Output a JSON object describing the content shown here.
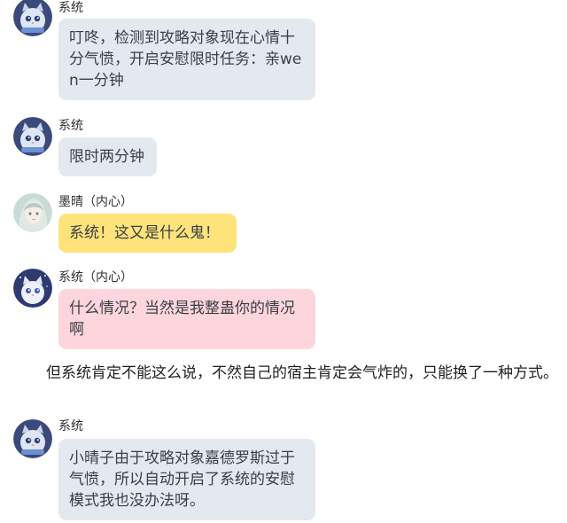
{
  "messages": [
    {
      "sender": "系统",
      "avatar": "cat-avatar-icon",
      "text": "叮咚，检测到攻略对象现在心情十分气愤，开启安慰限时任务：亲wen一分钟",
      "color": "#e4e8ef"
    },
    {
      "sender": "系统",
      "avatar": "cat-avatar-icon",
      "text": "限时两分钟",
      "color": "#e4e8ef"
    },
    {
      "sender": "墨晴（内心）",
      "avatar": "girl-avatar-icon",
      "text": "系统！这又是什么鬼！",
      "color": "#fde37a"
    },
    {
      "sender": "系统（内心）",
      "avatar": "cat-avatar-icon",
      "text": "什么情况？当然是我整蛊你的情况啊",
      "color": "#fdd5dd"
    },
    {
      "sender": "系统",
      "avatar": "cat-avatar-icon",
      "text": "小晴子由于攻略对象嘉德罗斯过于气愤，所以自动开启了系统的安慰模式我也没办法呀。",
      "color": "#e4e8ef"
    }
  ],
  "narration": "但系统肯定不能这么说，不然自己的宿主肯定会气炸的，只能换了一种方式。"
}
